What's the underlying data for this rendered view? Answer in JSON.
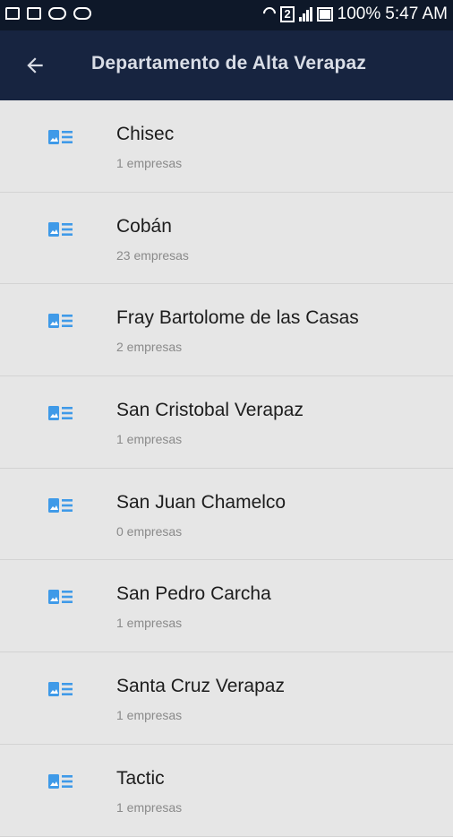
{
  "status_bar": {
    "left_icons": [
      "message-icon",
      "image-icon",
      "voicemail-icon",
      "voicemail-icon"
    ],
    "sim_label": "2",
    "battery_text": "100%",
    "time": "5:47 AM"
  },
  "app_bar": {
    "title": "Departamento de Alta Verapaz",
    "back_icon": "arrow-back-icon"
  },
  "colors": {
    "status_bar_bg": "#0e1829",
    "app_bar_bg": "#172440",
    "list_bg": "#e6e6e6",
    "icon_accent": "#3f9ae8"
  },
  "list": {
    "item_icon": "contact-card-icon",
    "items": [
      {
        "name": "Chisec",
        "count": "1 empresas"
      },
      {
        "name": "Cobán",
        "count": "23 empresas"
      },
      {
        "name": "Fray Bartolome de las Casas",
        "count": "2 empresas"
      },
      {
        "name": "San Cristobal Verapaz",
        "count": "1 empresas"
      },
      {
        "name": "San Juan Chamelco",
        "count": "0 empresas"
      },
      {
        "name": "San Pedro Carcha",
        "count": "1 empresas"
      },
      {
        "name": "Santa Cruz Verapaz",
        "count": "1 empresas"
      },
      {
        "name": "Tactic",
        "count": "1 empresas"
      }
    ]
  }
}
